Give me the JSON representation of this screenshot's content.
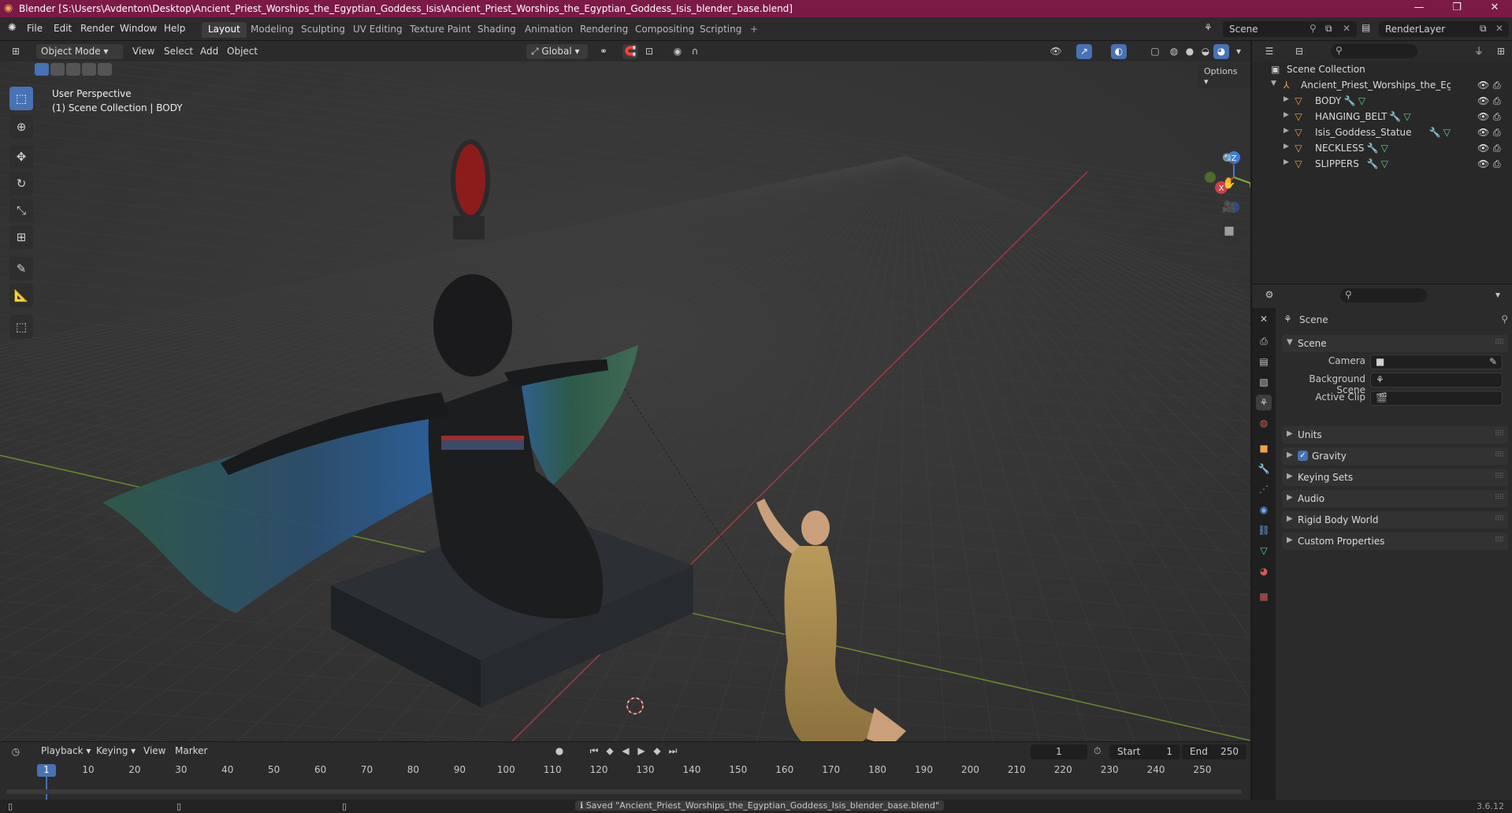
{
  "app": {
    "title": "Blender [S:\\Users\\Avdenton\\Desktop\\Ancient_Priest_Worships_the_Egyptian_Goddess_Isis\\Ancient_Priest_Worships_the_Egyptian_Goddess_Isis_blender_base.blend]",
    "version": "3.6.12"
  },
  "menu": [
    "File",
    "Edit",
    "Render",
    "Window",
    "Help"
  ],
  "workspaces": [
    "Layout",
    "Modeling",
    "Sculpting",
    "UV Editing",
    "Texture Paint",
    "Shading",
    "Animation",
    "Rendering",
    "Compositing",
    "Scripting"
  ],
  "active_workspace": "Layout",
  "scene_selector": "Scene",
  "render_layer": "RenderLayer",
  "viewport": {
    "mode": "Object Mode",
    "menus": [
      "View",
      "Select",
      "Add",
      "Object"
    ],
    "orientation": "Global",
    "options_label": "Options",
    "overlay_line1": "User Perspective",
    "overlay_line2": "(1) Scene Collection | BODY",
    "gizmo": {
      "x": "X",
      "y": "Y",
      "z": "Z"
    }
  },
  "outliner": {
    "root": "Scene Collection",
    "collection": "Ancient_Priest_Worships_the_Egyptian_(",
    "objects": [
      "BODY",
      "HANGING_BELT",
      "Isis_Goddess_Statue",
      "NECKLESS",
      "SLIPPERS"
    ]
  },
  "properties": {
    "header": "Scene",
    "section": "Scene",
    "camera_label": "Camera",
    "background_scene_label": "Background Scene",
    "active_clip_label": "Active Clip",
    "panels": [
      "Units",
      "Gravity",
      "Keying Sets",
      "Audio",
      "Rigid Body World",
      "Custom Properties"
    ],
    "gravity_checked": true
  },
  "timeline": {
    "menus": [
      "Playback",
      "Keying",
      "View",
      "Marker"
    ],
    "current_frame": "1",
    "start_label": "Start",
    "start": "1",
    "end_label": "End",
    "end": "250",
    "ruler": [
      "1",
      "10",
      "20",
      "30",
      "40",
      "50",
      "60",
      "70",
      "80",
      "90",
      "100",
      "110",
      "120",
      "130",
      "140",
      "150",
      "160",
      "170",
      "180",
      "190",
      "200",
      "210",
      "220",
      "230",
      "240",
      "250"
    ]
  },
  "status": {
    "message": "Saved \"Ancient_Priest_Worships_the_Egyptian_Goddess_Isis_blender_base.blend\""
  },
  "colors": {
    "title_bar": "#7a1a45",
    "accent": "#4772b3",
    "axis_x": "#c9414d",
    "axis_y": "#7fb33a",
    "axis_z": "#3d7ddb"
  }
}
